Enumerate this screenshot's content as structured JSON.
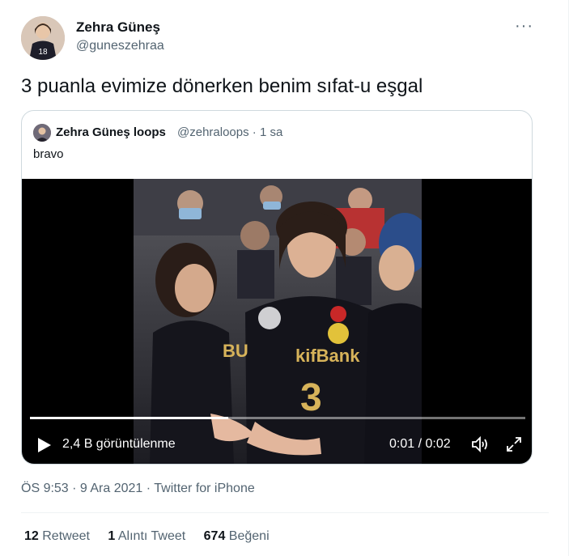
{
  "author": {
    "name": "Zehra Güneş",
    "handle": "@guneszehraa",
    "avatar_jersey": "18"
  },
  "more_icon": "more-options-icon",
  "tweet_text": "3 puanla evimize dönerken benim sıfat-u eşgal",
  "quote": {
    "name": "Zehra Güneş loops",
    "handle_time": "@zehraloops · 1 sa",
    "text": "bravo",
    "video": {
      "views": "2,4 B görüntülenme",
      "time": "0:01 / 0:02",
      "progress": 0.4,
      "jersey_text": "kifBank",
      "jersey_number": "3",
      "sleeve_text": "BU",
      "icons": [
        "play-icon",
        "volume-icon",
        "fullscreen-icon"
      ]
    }
  },
  "meta": "ÖS 9:53 · 9 Ara 2021 · Twitter for iPhone",
  "stats": {
    "retweets_count": "12",
    "retweets_label": "Retweet",
    "quotes_count": "1",
    "quotes_label": "Alıntı Tweet",
    "likes_count": "674",
    "likes_label": "Beğeni"
  },
  "colors": {
    "text": "#0f1419",
    "secondary": "#536471",
    "border": "#cfd9de"
  }
}
